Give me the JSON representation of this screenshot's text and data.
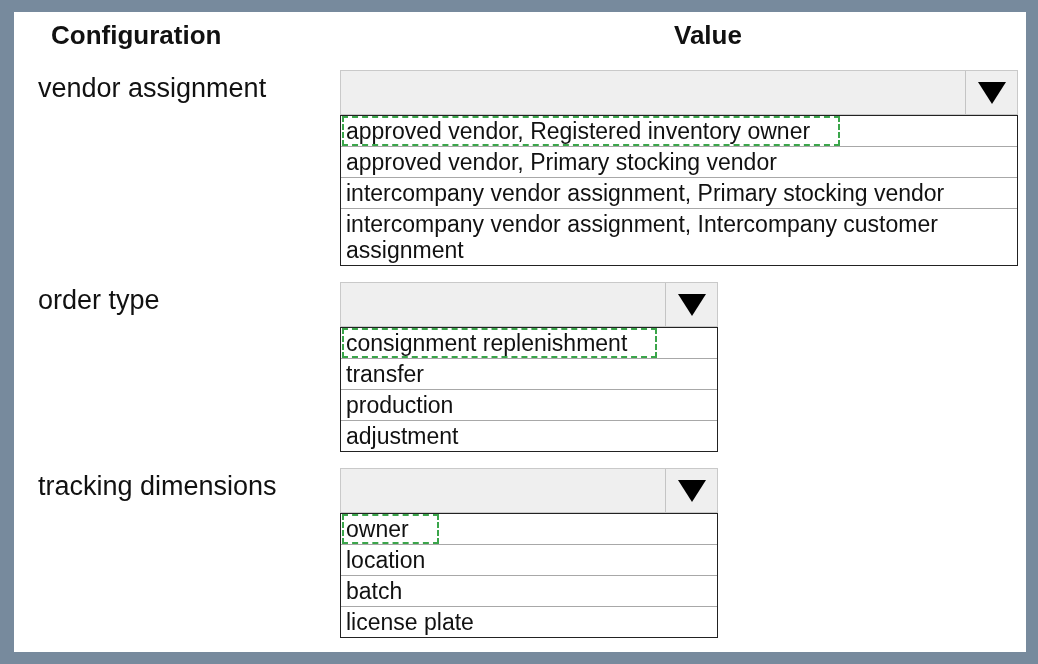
{
  "headers": [
    "Configuration",
    "Value"
  ],
  "rows": [
    {
      "label": "vendor assignment",
      "options": [
        {
          "text": "approved vendor, Registered inventory owner",
          "selected": true
        },
        {
          "text": "approved vendor, Primary stocking vendor",
          "selected": false
        },
        {
          "text": "intercompany vendor assignment, Primary stocking vendor",
          "selected": false
        },
        {
          "text": "intercompany vendor assignment, Intercompany customer assignment",
          "selected": false
        }
      ]
    },
    {
      "label": "order type",
      "options": [
        {
          "text": "consignment replenishment",
          "selected": true
        },
        {
          "text": "transfer",
          "selected": false
        },
        {
          "text": "production",
          "selected": false
        },
        {
          "text": "adjustment",
          "selected": false
        }
      ]
    },
    {
      "label": "tracking dimensions",
      "options": [
        {
          "text": "owner",
          "selected": true
        },
        {
          "text": "location",
          "selected": false
        },
        {
          "text": "batch",
          "selected": false
        },
        {
          "text": "license plate",
          "selected": false
        }
      ]
    }
  ]
}
